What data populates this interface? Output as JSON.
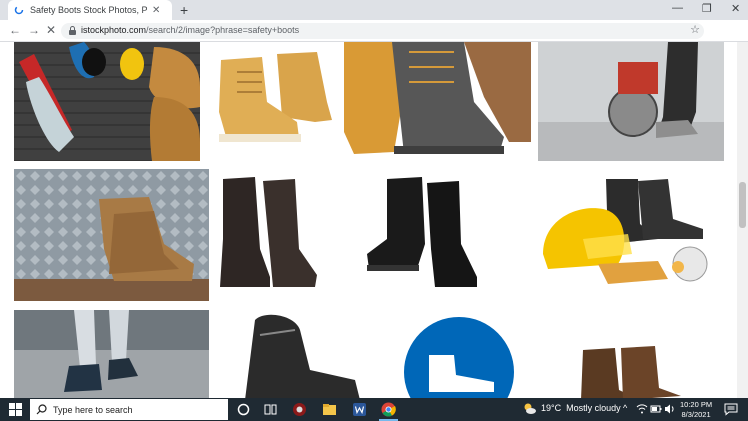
{
  "browser": {
    "tab_title": "Safety Boots Stock Photos, Pictu",
    "tab_close": "✕",
    "new_tab": "+",
    "url_host": "istockphoto.com",
    "url_path": "/search/2/image?phrase=safety+boots",
    "win_minimize": "—",
    "win_restore": "❐",
    "win_close": "✕",
    "back": "←",
    "forward": "→",
    "stop": "✕",
    "star": "☆",
    "ext_badge": "●"
  },
  "taskbar": {
    "search_placeholder": "Type here to search",
    "weather_temp": "19°C",
    "weather_text": "Mostly cloudy",
    "time": "10:20 PM",
    "date": "8/3/2021",
    "tray_up": "^"
  },
  "colors": {
    "taskbar": "#1f2a33",
    "tabbar": "#dee1e6",
    "accent_blue": "#0067b8"
  }
}
